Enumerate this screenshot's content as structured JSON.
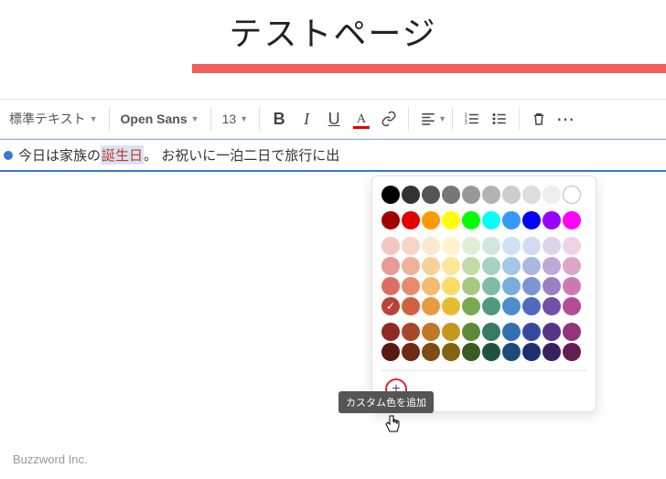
{
  "header": {
    "title": "テストページ"
  },
  "toolbar": {
    "style_select": "標準テキスト",
    "font_select": "Open Sans",
    "size_select": "13"
  },
  "content": {
    "prefix": "今日は家族の",
    "highlight": "誕生日",
    "suffix": "。 お祝いに一泊二日で旅行に出"
  },
  "picker": {
    "tooltip": "カスタム色を追加",
    "greys": [
      "#000000",
      "#333333",
      "#555555",
      "#777777",
      "#999999",
      "#b3b3b3",
      "#cccccc",
      "#dddddd",
      "#eeeeee",
      "#ffffff"
    ],
    "row_vivid": [
      "#a40000",
      "#e60000",
      "#ff9900",
      "#ffff00",
      "#00ff00",
      "#00ffff",
      "#3399ff",
      "#0000ff",
      "#9900ff",
      "#ff00ff"
    ],
    "rows_pastel": [
      [
        "#f3c6c2",
        "#f8d4c6",
        "#fce8cc",
        "#fff4cc",
        "#e0eed4",
        "#d2e6e0",
        "#cfe1f3",
        "#d2dbf0",
        "#ddd4ea",
        "#efd2e4"
      ],
      [
        "#e79b94",
        "#f1b09a",
        "#f8d29a",
        "#ffe799",
        "#c3dba9",
        "#a9d0c4",
        "#a4c7e8",
        "#a9b8e2",
        "#bca9d6",
        "#dfa6cb"
      ],
      [
        "#db6e63",
        "#e98a6d",
        "#f3bb6b",
        "#ffda66",
        "#a6c97f",
        "#80bba9",
        "#78addd",
        "#7f94d4",
        "#9b7fc2",
        "#cf79b2"
      ],
      [
        "#b84338",
        "#d1603f",
        "#e79b3d",
        "#e9bb2f",
        "#7aa951",
        "#4f9982",
        "#4b8ecc",
        "#5068bd",
        "#7350a7",
        "#b34c95"
      ]
    ],
    "rows_dark": [
      [
        "#8e2a21",
        "#a8462a",
        "#c07826",
        "#c4981c",
        "#5b8a38",
        "#367a63",
        "#326fae",
        "#34499f",
        "#54358a",
        "#92347a"
      ],
      [
        "#571912",
        "#6e2a17",
        "#7e4d15",
        "#836310",
        "#3a5b22",
        "#205242",
        "#1d4a79",
        "#1e2f6e",
        "#37215e",
        "#611f52"
      ]
    ],
    "selected": "#b84338"
  },
  "footer": {
    "text": "Buzzword Inc."
  }
}
